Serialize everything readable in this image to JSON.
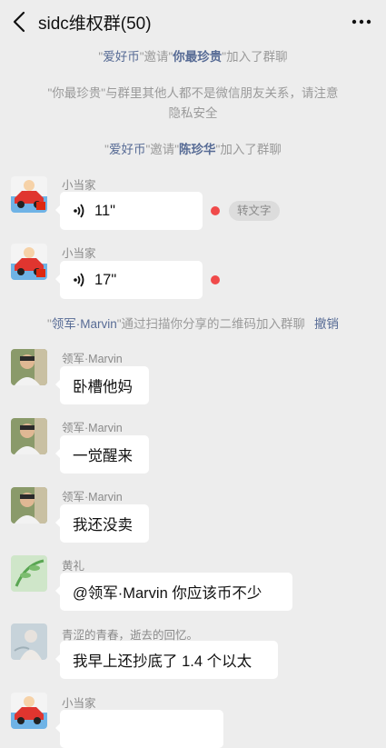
{
  "header": {
    "title": "sidc维权群(50)"
  },
  "system": [
    {
      "quote1": "\"",
      "name1": "爱好币",
      "mid": "\"邀请\"",
      "name2": "你最珍贵",
      "tail": "\"加入了群聊"
    },
    {
      "line1": "\"你最珍贵\"与群里其他人都不是微信朋友关系，请注意",
      "line2": "隐私安全"
    },
    {
      "quote1": "\"",
      "name1": "爱好币",
      "mid": "\"邀请\"",
      "name2": "陈珍华",
      "tail": "\"加入了群聊"
    },
    {
      "quote1": "\"",
      "name1": "领军·Marvin",
      "tail": "\"通过扫描你分享的二维码加入群聊",
      "action": "撤销"
    }
  ],
  "messages": [
    {
      "sender": "小当家",
      "type": "voice",
      "text": "11\"",
      "unread": true,
      "transcribe": "转文字"
    },
    {
      "sender": "小当家",
      "type": "voice",
      "text": "17\"",
      "unread": true
    },
    {
      "sender": "领军·Marvin",
      "type": "text",
      "text": "卧槽他妈"
    },
    {
      "sender": "领军·Marvin",
      "type": "text",
      "text": "一觉醒来"
    },
    {
      "sender": "领军·Marvin",
      "type": "text",
      "text": "我还没卖"
    },
    {
      "sender": "黄礼",
      "type": "text",
      "text": "@领军·Marvin 你应该币不少"
    },
    {
      "sender": "青涩的青春，逝去的回忆。",
      "type": "text",
      "text": "我早上还抄底了 1.4 个以太"
    },
    {
      "sender": "小当家",
      "type": "text",
      "text": ""
    }
  ],
  "colors": {
    "background": "#ededed",
    "link": "#576b95",
    "unread_dot": "#f04a4a"
  }
}
